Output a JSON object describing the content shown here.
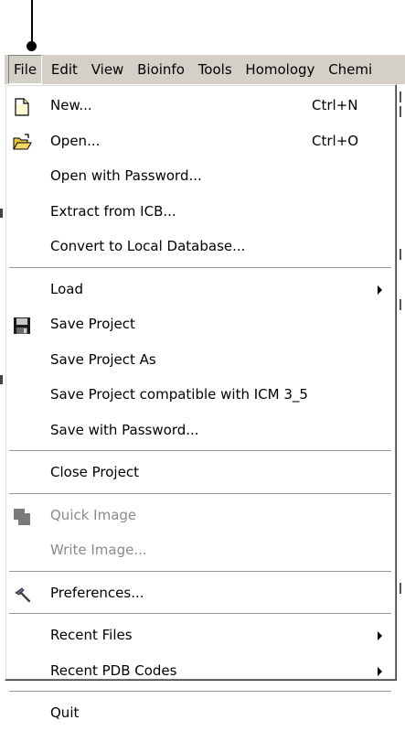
{
  "menubar": {
    "items": [
      "File",
      "Edit",
      "View",
      "Bioinfo",
      "Tools",
      "Homology",
      "Chemi"
    ]
  },
  "file_menu": {
    "groups": [
      [
        {
          "label": "New...",
          "shortcut": "Ctrl+N",
          "icon": "new-file-icon"
        },
        {
          "label": "Open...",
          "shortcut": "Ctrl+O",
          "icon": "open-folder-icon"
        },
        {
          "label": "Open with Password..."
        },
        {
          "label": "Extract from ICB..."
        },
        {
          "label": "Convert to Local Database..."
        }
      ],
      [
        {
          "label": "Load",
          "submenu": true
        },
        {
          "label": "Save Project",
          "icon": "save-disk-icon"
        },
        {
          "label": "Save Project As"
        },
        {
          "label": "Save Project compatible with ICM 3_5"
        },
        {
          "label": "Save with Password..."
        }
      ],
      [
        {
          "label": "Close Project"
        }
      ],
      [
        {
          "label": "Quick Image",
          "icon": "quick-image-icon",
          "disabled": true
        },
        {
          "label": "Write Image...",
          "disabled": true
        }
      ],
      [
        {
          "label": "Preferences...",
          "icon": "hammer-icon"
        }
      ],
      [
        {
          "label": "Recent Files",
          "submenu": true
        },
        {
          "label": "Recent PDB Codes",
          "submenu": true
        }
      ],
      [
        {
          "label": "Quit"
        }
      ]
    ]
  },
  "colors": {
    "menubar_bg": "#d4d0c8",
    "menu_bg": "#ffffff",
    "disabled_text": "#8a8a8a",
    "separator": "#9a9a9a"
  }
}
